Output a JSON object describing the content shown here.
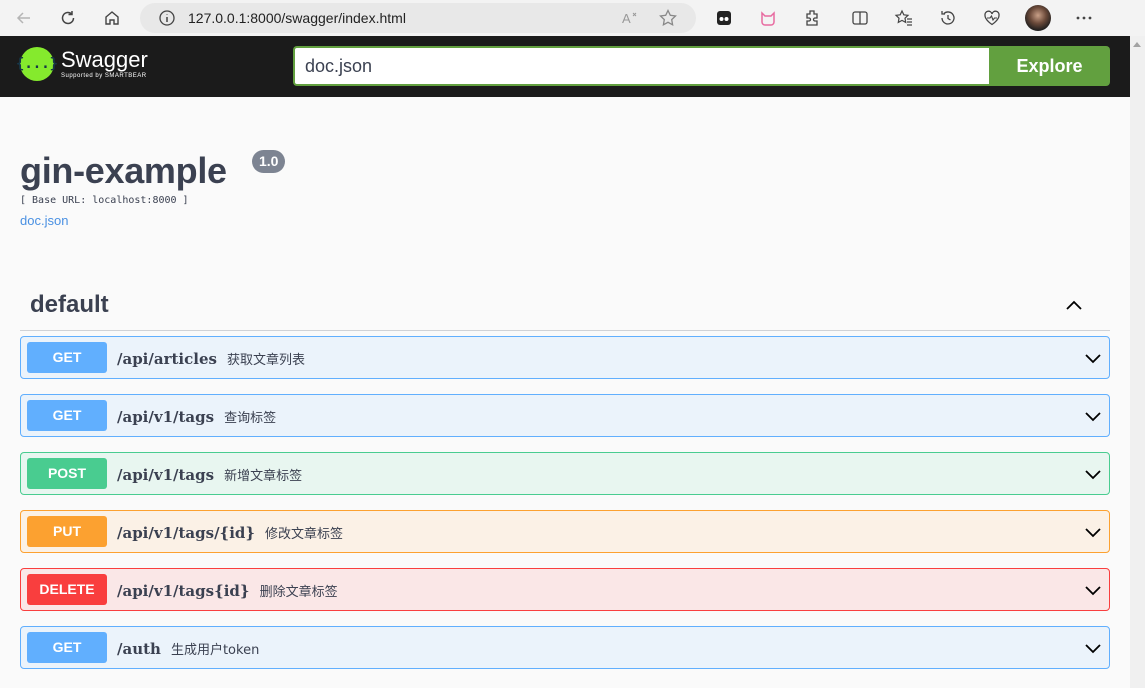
{
  "browser": {
    "url": "127.0.0.1:8000/swagger/index.html"
  },
  "header": {
    "logo_name": "Swagger",
    "logo_sub": "Supported by SMARTBEAR",
    "logo_mark": "{...}",
    "search_value": "doc.json",
    "explore_label": "Explore"
  },
  "info": {
    "title": "gin-example",
    "version": "1.0",
    "base_url": "[ Base URL: localhost:8000 ]",
    "doc_link": "doc.json"
  },
  "tag": {
    "name": "default"
  },
  "operations": [
    {
      "method": "GET",
      "path": "/api/articles",
      "summary": "获取文章列表"
    },
    {
      "method": "GET",
      "path": "/api/v1/tags",
      "summary": "查询标签"
    },
    {
      "method": "POST",
      "path": "/api/v1/tags",
      "summary": "新增文章标签"
    },
    {
      "method": "PUT",
      "path": "/api/v1/tags/{id}",
      "summary": "修改文章标签"
    },
    {
      "method": "DELETE",
      "path": "/api/v1/tags{id}",
      "summary": "删除文章标签"
    },
    {
      "method": "GET",
      "path": "/auth",
      "summary": "生成用户token"
    }
  ],
  "colors": {
    "get": "#61affe",
    "post": "#49cc90",
    "put": "#fca130",
    "delete": "#f93e3e",
    "accent": "#62a03f"
  },
  "icons": [
    "back-arrow-icon",
    "reload-icon",
    "home-icon",
    "info-icon",
    "read-aloud-icon",
    "favorite-star-icon",
    "extension-icon",
    "split-screen-icon",
    "favorites-icon",
    "history-icon",
    "heart-pulse-icon",
    "more-icon",
    "chevron-up-icon",
    "chevron-down-icon"
  ]
}
